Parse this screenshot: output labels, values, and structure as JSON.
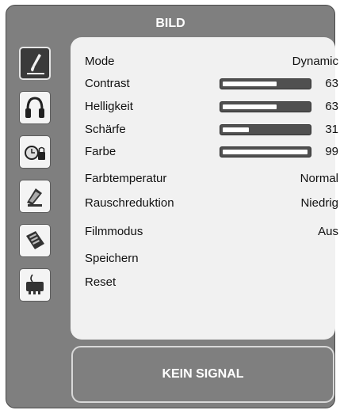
{
  "title": "BILD",
  "icons": [
    "picture-brush-icon",
    "headphones-icon",
    "clock-lock-icon",
    "satellite-dish-icon",
    "document-icon",
    "connector-icon"
  ],
  "menu": {
    "mode": {
      "label": "Mode",
      "value": "Dynamic"
    },
    "contrast": {
      "label": "Contrast",
      "value": "63",
      "level": 63
    },
    "helligkeit": {
      "label": "Helligkeit",
      "value": "63",
      "level": 63
    },
    "schaerfe": {
      "label": "Schärfe",
      "value": "31",
      "level": 31
    },
    "farbe": {
      "label": "Farbe",
      "value": "99",
      "level": 99
    },
    "farbtemperatur": {
      "label": "Farbtemperatur",
      "value": "Normal"
    },
    "rauschreduktion": {
      "label": "Rauschreduktion",
      "value": "Niedrig"
    },
    "filmmodus": {
      "label": "Filmmodus",
      "value": "Aus"
    },
    "speichern": {
      "label": "Speichern"
    },
    "reset": {
      "label": "Reset"
    }
  },
  "status": "KEIN SIGNAL"
}
